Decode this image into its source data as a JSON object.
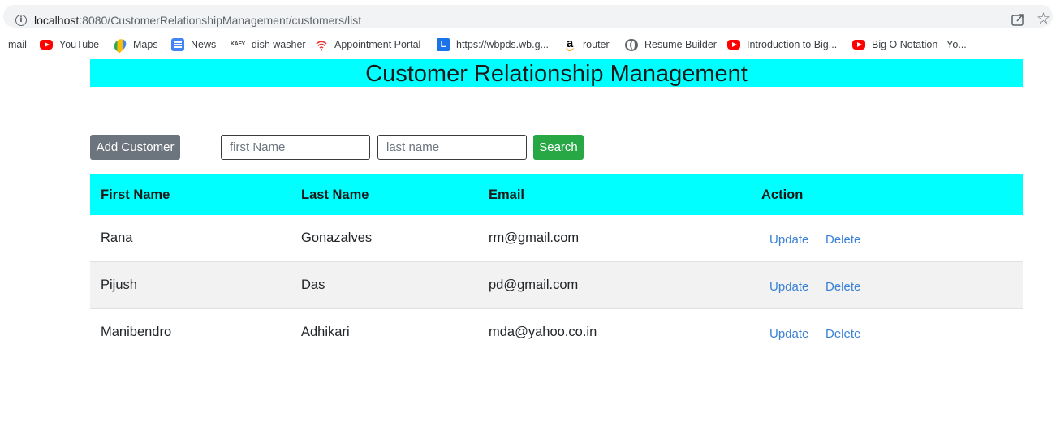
{
  "browser": {
    "url_host": "localhost",
    "url_rest": ":8080/CustomerRelationshipManagement/customers/list",
    "bookmarks": [
      {
        "label": "mail",
        "icon": "none"
      },
      {
        "label": "YouTube",
        "icon": "youtube-icon"
      },
      {
        "label": "Maps",
        "icon": "maps-icon"
      },
      {
        "label": "News",
        "icon": "news-icon"
      },
      {
        "label": "dish washer",
        "icon": "kafy-icon"
      },
      {
        "label": "Appointment Portal",
        "icon": "signal-icon"
      },
      {
        "label": "https://wbpds.wb.g...",
        "icon": "l-icon"
      },
      {
        "label": "router",
        "icon": "amazon-icon"
      },
      {
        "label": "Resume Builder",
        "icon": "globe-icon"
      },
      {
        "label": "Introduction to Big...",
        "icon": "youtube-icon"
      },
      {
        "label": "Big O Notation - Yo...",
        "icon": "youtube-icon"
      }
    ]
  },
  "page": {
    "title": "Customer Relationship Management",
    "add_button": "Add Customer",
    "first_name_placeholder": "first Name",
    "last_name_placeholder": "last name",
    "search_button": "Search"
  },
  "table": {
    "headers": [
      "First Name",
      "Last Name",
      "Email",
      "Action"
    ],
    "rows": [
      {
        "first": "Rana",
        "last": "Gonazalves",
        "email": "rm@gmail.com",
        "update": "Update",
        "delete": "Delete"
      },
      {
        "first": "Pijush",
        "last": "Das",
        "email": "pd@gmail.com",
        "update": "Update",
        "delete": "Delete"
      },
      {
        "first": "Manibendro",
        "last": "Adhikari",
        "email": "mda@yahoo.co.in",
        "update": "Update",
        "delete": "Delete"
      }
    ]
  },
  "colors": {
    "header_bg": "#00ffff",
    "add_button_bg": "#6c757d",
    "search_button_bg": "#28a745",
    "link": "#3b82d6",
    "row_alt": "#f2f2f2"
  }
}
